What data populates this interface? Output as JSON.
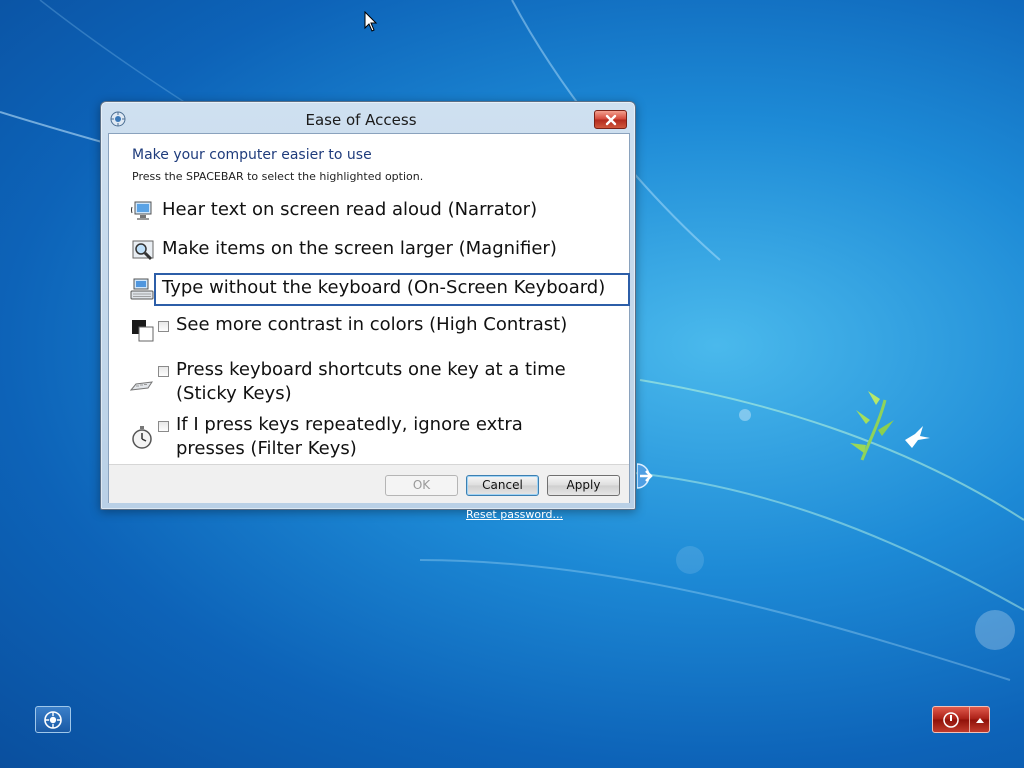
{
  "dialog": {
    "title": "Ease of Access",
    "heading": "Make your computer easier to use",
    "instruction": "Press the SPACEBAR to select the highlighted option.",
    "options": [
      {
        "label": "Hear text on screen read aloud (Narrator)",
        "icon": "narrator-icon"
      },
      {
        "label": "Make items on the screen larger (Magnifier)",
        "icon": "magnifier-icon"
      },
      {
        "label": "Type without the keyboard (On-Screen Keyboard)",
        "icon": "keyboard-icon",
        "focused": true
      },
      {
        "label": "See more contrast in colors (High Contrast)",
        "icon": "high-contrast-icon",
        "checked": false
      },
      {
        "label_line1": "Press keyboard shortcuts one key at a time",
        "label_line2": "(Sticky Keys)",
        "icon": "sticky-keys-icon",
        "checked": false
      },
      {
        "label_line1": "If I press keys repeatedly, ignore extra",
        "label_line2": "presses (Filter Keys)",
        "icon": "stopwatch-icon",
        "checked": false
      }
    ],
    "buttons": {
      "ok": "OK",
      "cancel": "Cancel",
      "apply": "Apply"
    }
  },
  "login": {
    "reset_password": "Reset password..."
  },
  "colors": {
    "accent": "#2c5ea8",
    "power": "#a81d14"
  }
}
